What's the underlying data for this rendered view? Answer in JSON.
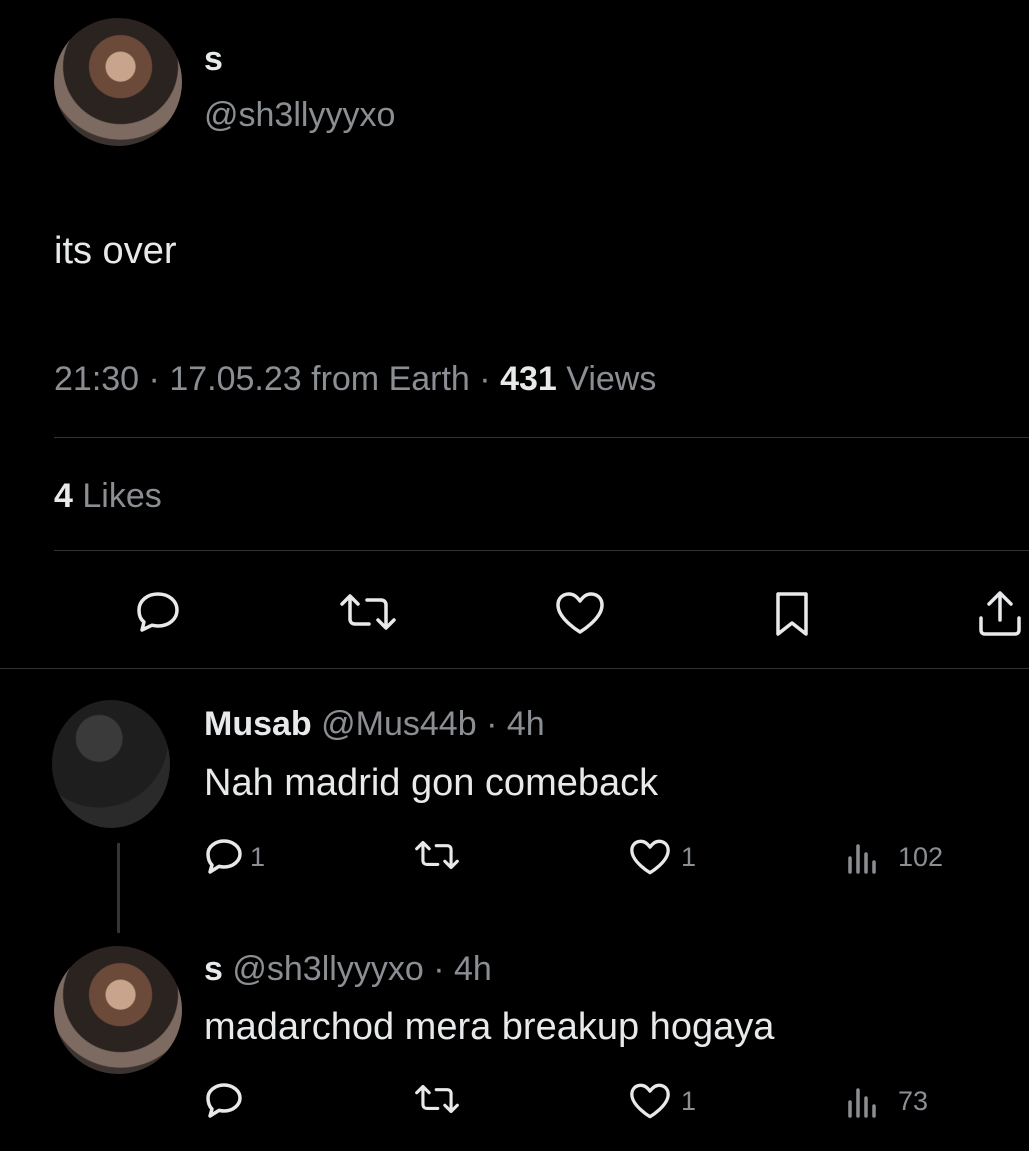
{
  "tweet": {
    "display_name": "s",
    "handle": "@sh3llyyyxo",
    "text": "its over",
    "time": "21:30",
    "date": "17.05.23 from Earth",
    "views_count": "431",
    "views_label": "Views",
    "likes_count": "4",
    "likes_label": "Likes",
    "actions": [
      "reply-icon",
      "retweet-icon",
      "like-icon",
      "bookmark-icon",
      "share-icon"
    ]
  },
  "replies": [
    {
      "display_name": "Musab",
      "handle": "@Mus44b",
      "time": "4h",
      "text": "Nah madrid gon comeback",
      "reply_count": "1",
      "retweet_count": "",
      "like_count": "1",
      "views_count": "102"
    },
    {
      "display_name": "s",
      "handle": "@sh3llyyyxo",
      "time": "4h",
      "text": "madarchod mera breakup hogaya",
      "reply_count": "",
      "retweet_count": "",
      "like_count": "1",
      "views_count": "73"
    }
  ],
  "colors": {
    "background": "#000000",
    "text": "#e7e9ea",
    "secondary": "#8b8f94",
    "divider": "#2f3336"
  }
}
